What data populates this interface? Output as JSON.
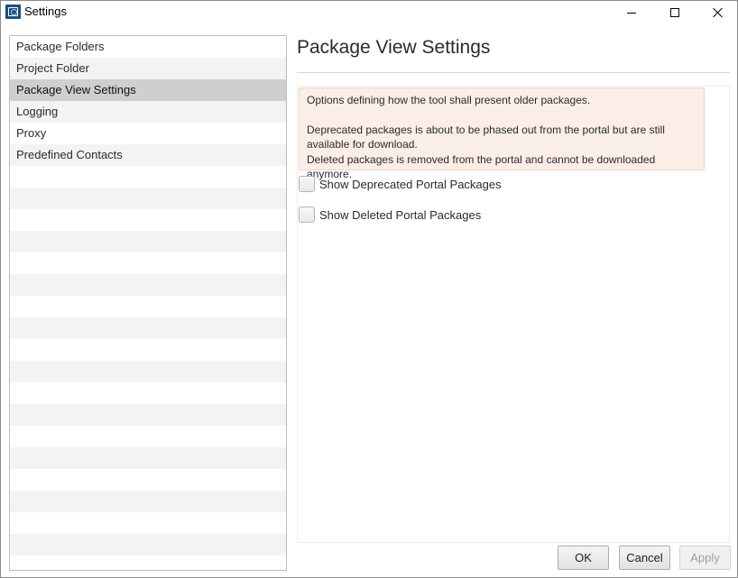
{
  "window": {
    "title": "Settings"
  },
  "titlebar": {
    "minimize_icon": "minimize-icon",
    "maximize_icon": "maximize-icon",
    "close_icon": "close-icon"
  },
  "nav": {
    "items": [
      {
        "label": "Package Folders",
        "selected": false
      },
      {
        "label": "Project Folder",
        "selected": false
      },
      {
        "label": "Package View Settings",
        "selected": true
      },
      {
        "label": "Logging",
        "selected": false
      },
      {
        "label": "Proxy",
        "selected": false
      },
      {
        "label": "Predefined Contacts",
        "selected": false
      }
    ]
  },
  "main": {
    "title": "Package View Settings",
    "info_line1": "Options defining how the tool shall present older packages.",
    "info_line2": "Deprecated packages is about to be phased out from the portal but are still available for download.",
    "info_line3": "Deleted packages is removed from the portal and cannot be downloaded anymore.",
    "checkbox_deprecated": {
      "label": "Show Deprecated Portal Packages",
      "checked": false
    },
    "checkbox_deleted": {
      "label": "Show Deleted Portal Packages",
      "checked": false
    }
  },
  "footer": {
    "ok_label": "OK",
    "cancel_label": "Cancel",
    "apply_label": "Apply",
    "apply_enabled": false
  },
  "colors": {
    "selected_row": "#cfcfcf",
    "info_background": "#fbeee6"
  }
}
